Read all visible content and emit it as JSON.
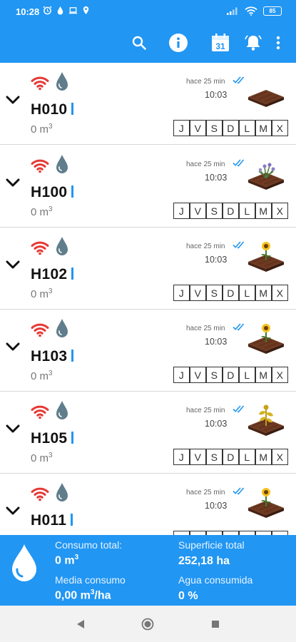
{
  "status_bar": {
    "time": "10:28",
    "battery": "85",
    "left_icons": [
      "alarm-clock-icon",
      "water-drop-icon",
      "laptop-icon",
      "location-icon"
    ],
    "right_icons": [
      "signal-icon",
      "wifi-icon",
      "battery-icon"
    ]
  },
  "app_bar": {
    "color": "#2196f3",
    "actions": [
      "search-icon",
      "info-icon",
      "calendar-icon",
      "bell-icon",
      "more-vert-icon"
    ],
    "calendar_day": "31"
  },
  "rows": [
    {
      "name": "H010",
      "volume": "0 m",
      "volume_unit_sup": "3",
      "time_ago": "hace 25 min",
      "time": "10:03",
      "plant": "soil",
      "days": [
        "J",
        "V",
        "S",
        "D",
        "L",
        "M",
        "X"
      ]
    },
    {
      "name": "H100",
      "volume": "0 m",
      "volume_unit_sup": "3",
      "time_ago": "hace 25 min",
      "time": "10:03",
      "plant": "lavender",
      "days": [
        "J",
        "V",
        "S",
        "D",
        "L",
        "M",
        "X"
      ]
    },
    {
      "name": "H102",
      "volume": "0 m",
      "volume_unit_sup": "3",
      "time_ago": "hace 25 min",
      "time": "10:03",
      "plant": "sunflower",
      "days": [
        "J",
        "V",
        "S",
        "D",
        "L",
        "M",
        "X"
      ]
    },
    {
      "name": "H103",
      "volume": "0 m",
      "volume_unit_sup": "3",
      "time_ago": "hace 25 min",
      "time": "10:03",
      "plant": "sunflower",
      "days": [
        "J",
        "V",
        "S",
        "D",
        "L",
        "M",
        "X"
      ]
    },
    {
      "name": "H105",
      "volume": "0 m",
      "volume_unit_sup": "3",
      "time_ago": "hace 25 min",
      "time": "10:03",
      "plant": "dry-sunflower",
      "days": [
        "J",
        "V",
        "S",
        "D",
        "L",
        "M",
        "X"
      ]
    },
    {
      "name": "H011",
      "volume": "",
      "volume_unit_sup": "",
      "time_ago": "hace 25 min",
      "time": "10:03",
      "plant": "sunflower",
      "days": []
    }
  ],
  "summary": {
    "consumo_total_label": "Consumo total:",
    "consumo_total_value": "0 m",
    "consumo_total_sup": "3",
    "superficie_total_label": "Superficie total",
    "superficie_total_value": "252,18 ha",
    "media_consumo_label": "Media consumo",
    "media_consumo_value": "0,00 m",
    "media_consumo_sup": "3",
    "media_consumo_suffix": "/ha",
    "agua_consumida_label": "Agua consumida",
    "agua_consumida_value": "0 %"
  },
  "nav_bar": {
    "buttons": [
      "back-icon",
      "home-icon",
      "recents-icon"
    ]
  },
  "colors": {
    "primary": "#2196f3",
    "wifi_status": "#e53935",
    "water_drop": "#607d8b",
    "read_check": "#2196f3",
    "soil": "#5d2e1a"
  }
}
